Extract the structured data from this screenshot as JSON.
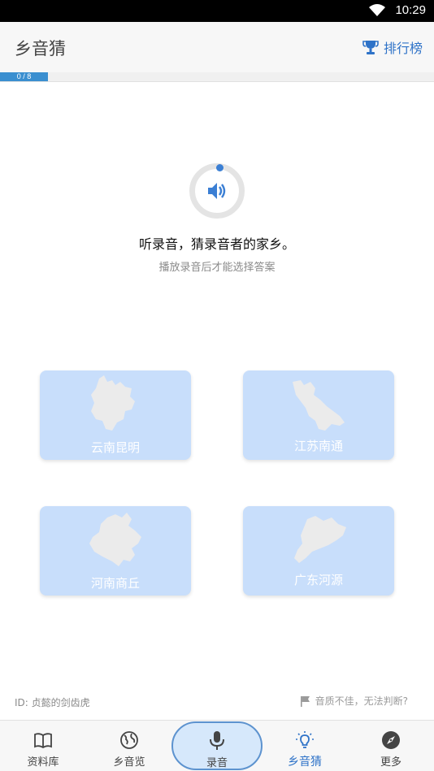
{
  "status_bar": {
    "time": "10:29"
  },
  "header": {
    "title": "乡音猜",
    "leaderboard_label": "排行榜"
  },
  "progress": {
    "text": "0 / 8",
    "current": 0,
    "total": 8
  },
  "player": {
    "prompt": "听录音，猜录音者的家乡。",
    "hint": "播放录音后才能选择答案"
  },
  "options": [
    {
      "label": "云南昆明"
    },
    {
      "label": "江苏南通"
    },
    {
      "label": "河南商丘"
    },
    {
      "label": "广东河源"
    }
  ],
  "footer": {
    "id_text": "ID: 贞懿的剑齿虎",
    "report_label": "音质不佳，无法判断?"
  },
  "nav": {
    "items": [
      {
        "label": "资料库",
        "icon": "book-icon"
      },
      {
        "label": "乡音览",
        "icon": "globe-icon"
      },
      {
        "label": "录音",
        "icon": "microphone-icon"
      },
      {
        "label": "乡音猜",
        "icon": "lightbulb-icon"
      },
      {
        "label": "更多",
        "icon": "compass-icon"
      }
    ],
    "active_index": 3
  },
  "colors": {
    "accent": "#2f73c8",
    "card_bg": "#c8defb",
    "progress": "#3a8fd0"
  }
}
